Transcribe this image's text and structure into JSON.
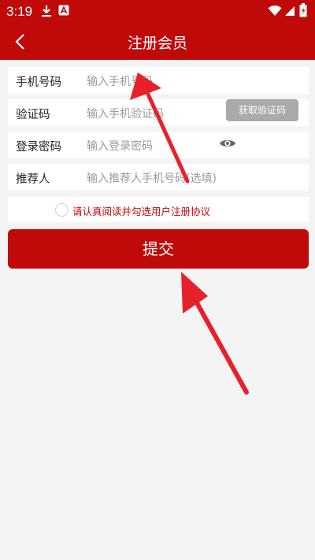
{
  "status": {
    "time": "3:19",
    "icons": [
      "download-icon",
      "a-app-icon",
      "wifi-icon",
      "signal-icon",
      "battery-icon"
    ]
  },
  "header": {
    "title": "注册会员",
    "back_icon": "chevron-left-icon",
    "color": "#c00a0a"
  },
  "form": {
    "phone": {
      "label": "手机号码",
      "placeholder": "输入手机号码"
    },
    "code": {
      "label": "验证码",
      "placeholder": "输入手机验证码",
      "button": "获取验证码"
    },
    "password": {
      "label": "登录密码",
      "placeholder": "输入登录密码",
      "toggle_icon": "eye-icon"
    },
    "referrer": {
      "label": "推荐人",
      "placeholder": "输入推荐人手机号码(选填)"
    }
  },
  "agreement": {
    "text": "请认真阅读并勾选用户注册协议"
  },
  "submit": {
    "label": "提交"
  },
  "colors": {
    "accent": "#c00a0a",
    "background": "#f4f4f4",
    "annotation_arrow": "#e8202a"
  }
}
